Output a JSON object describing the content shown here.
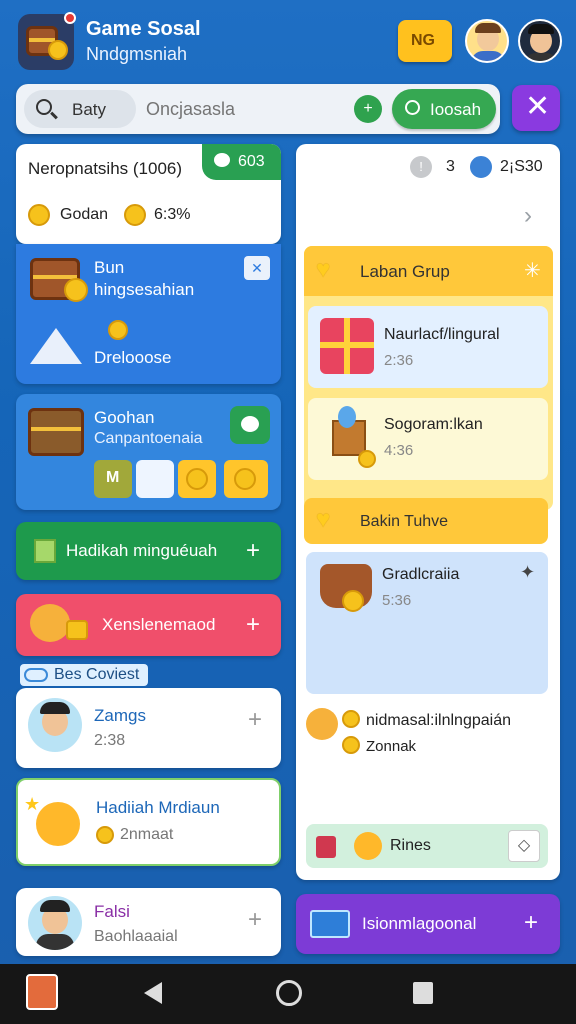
{
  "header": {
    "title": "Game Sosal",
    "subtitle": "Nndgmsniah",
    "badge_label": "NG"
  },
  "search": {
    "chip_label": "Baty",
    "placeholder": "Oncjasasla",
    "button_label": "Ioosah"
  },
  "left": {
    "profile_card": {
      "title": "Neropnatsihs (1006)",
      "tag": "603",
      "coin1": "Godan",
      "coin2": "6:3%"
    },
    "blue_card": {
      "title": "Bun",
      "subtitle": "hingsesahian",
      "label": "Drelooose"
    },
    "gift_card": {
      "title": "Goohan",
      "subtitle": "Canpantoenaia",
      "tile1": "M"
    },
    "green_button": "Hadikah minguéuah",
    "red_button": "Xenslenemaod",
    "section_label": "Bes Coviest",
    "list": [
      {
        "name": "Zamgs",
        "sub": "2:38"
      },
      {
        "name": "Hadiiah Mrdiaun",
        "sub": "2nmaat"
      },
      {
        "name": "Falsi",
        "sub": "Baohlaaaial"
      }
    ]
  },
  "right": {
    "stat_count": "3",
    "stat_value": "2¡S30",
    "group1_title": "Laban Grup",
    "items": [
      {
        "name": "Naurlacf/lingural",
        "time": "2:36"
      },
      {
        "name": "Sogoram:lkan",
        "time": "4:36"
      }
    ],
    "group2_title": "Bakin Tuhve",
    "item3": {
      "name": "Gradlcraiia",
      "time": "5:36"
    },
    "promo_text": "nidmasal:ilnlngpaián",
    "promo_sub": "Zonnak",
    "rines_label": "Rines",
    "purple_button": "Isionmlagoonal"
  },
  "colors": {
    "blue": "#2d7be0",
    "green": "#1e9a4c",
    "red": "#f04f6b",
    "yellow": "#ffc83a",
    "purple": "#7d3bd6"
  }
}
